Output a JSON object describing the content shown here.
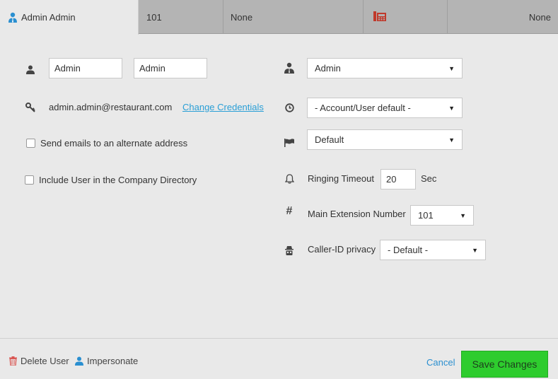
{
  "tabs": {
    "user_name": "Admin Admin",
    "extension": "101",
    "device": "None",
    "phone_label": "None"
  },
  "form": {
    "first_name": "Admin",
    "last_name": "Admin",
    "email": "admin.admin@restaurant.com",
    "change_credentials": "Change Credentials",
    "alt_email_label": "Send emails to an alternate address",
    "directory_label": "Include User in the Company Directory",
    "role_value": "Admin",
    "timezone_value": "- Account/User default -",
    "language_value": "Default",
    "ringing_timeout_label": "Ringing Timeout",
    "ringing_timeout_value": "20",
    "ringing_timeout_unit": "Sec",
    "main_ext_label": "Main Extension Number",
    "main_ext_value": "101",
    "caller_id_label": "Caller-ID privacy",
    "caller_id_value": "- Default -"
  },
  "footer": {
    "delete_label": "Delete User",
    "impersonate_label": "Impersonate",
    "cancel_label": "Cancel",
    "save_label": "Save Changes"
  },
  "colors": {
    "accent": "#2a9fd6",
    "save_button": "#2ecc2e",
    "delete_icon": "#d9534f",
    "phone_icon": "#c0392b"
  }
}
